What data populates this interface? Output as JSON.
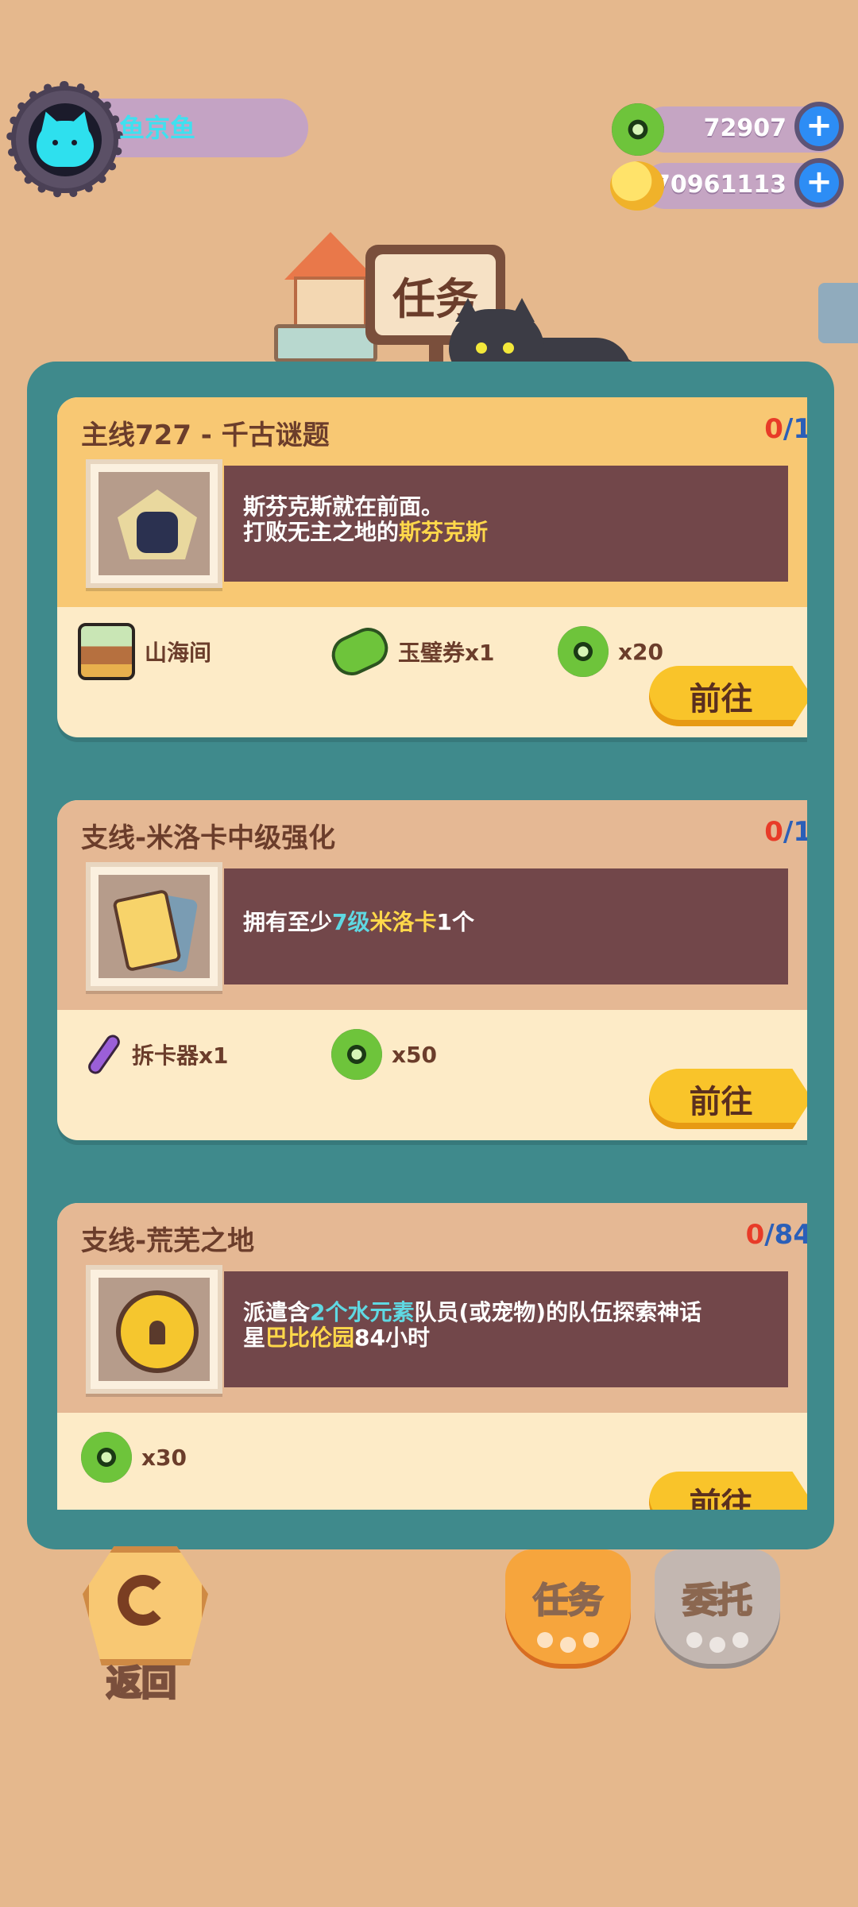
{
  "player": {
    "name": "鱼京鱼"
  },
  "currencies": [
    {
      "type": "jade",
      "value": "72907"
    },
    {
      "type": "gold",
      "value": "70961113"
    }
  ],
  "title": "任务",
  "tasks": [
    {
      "kind": "main",
      "title": "主线727 - 千古谜题",
      "progress_current": "0",
      "progress_total": "1",
      "desc_line1": "斯芬克斯就在前面。",
      "desc_line2_a": "打败无主之地的",
      "desc_line2_hl": "斯芬克斯",
      "rewards": [
        {
          "icon": "shanhaijian-icon",
          "label": "山海间"
        },
        {
          "icon": "jade-ticket-icon",
          "label": "玉璧券x1"
        },
        {
          "icon": "jade-coin-icon",
          "label": "x20"
        }
      ],
      "go_label": "前往"
    },
    {
      "kind": "side",
      "title": "支线-米洛卡中级强化",
      "progress_current": "0",
      "progress_total": "1",
      "desc_a": "拥有至少",
      "desc_b": "7级",
      "desc_c": "米洛卡",
      "desc_d": "1个",
      "rewards": [
        {
          "icon": "card-remover-icon",
          "label": "拆卡器x1"
        },
        {
          "icon": "jade-coin-icon",
          "label": "x50"
        }
      ],
      "go_label": "前往"
    },
    {
      "kind": "side",
      "title": "支线-荒芜之地",
      "progress_current": "0",
      "progress_total": "84",
      "desc_l1_a": "派遣含",
      "desc_l1_b": "2个水元素",
      "desc_l1_c": "队员(或宠物)的队伍探索神话",
      "desc_l2_a": "星",
      "desc_l2_b": "巴比伦园",
      "desc_l2_c": "84小时",
      "rewards": [
        {
          "icon": "jade-coin-icon",
          "label": "x30"
        }
      ],
      "go_label": "前往"
    }
  ],
  "bottom": {
    "back_label": "返回",
    "tab_task_label": "任务",
    "tab_commission_label": "委托"
  },
  "colors": {
    "panel": "#3f8a8c",
    "background": "#e5b88d",
    "main_header": "#f8c873",
    "side_header": "#e5b894",
    "go_button": "#f9c42a"
  }
}
